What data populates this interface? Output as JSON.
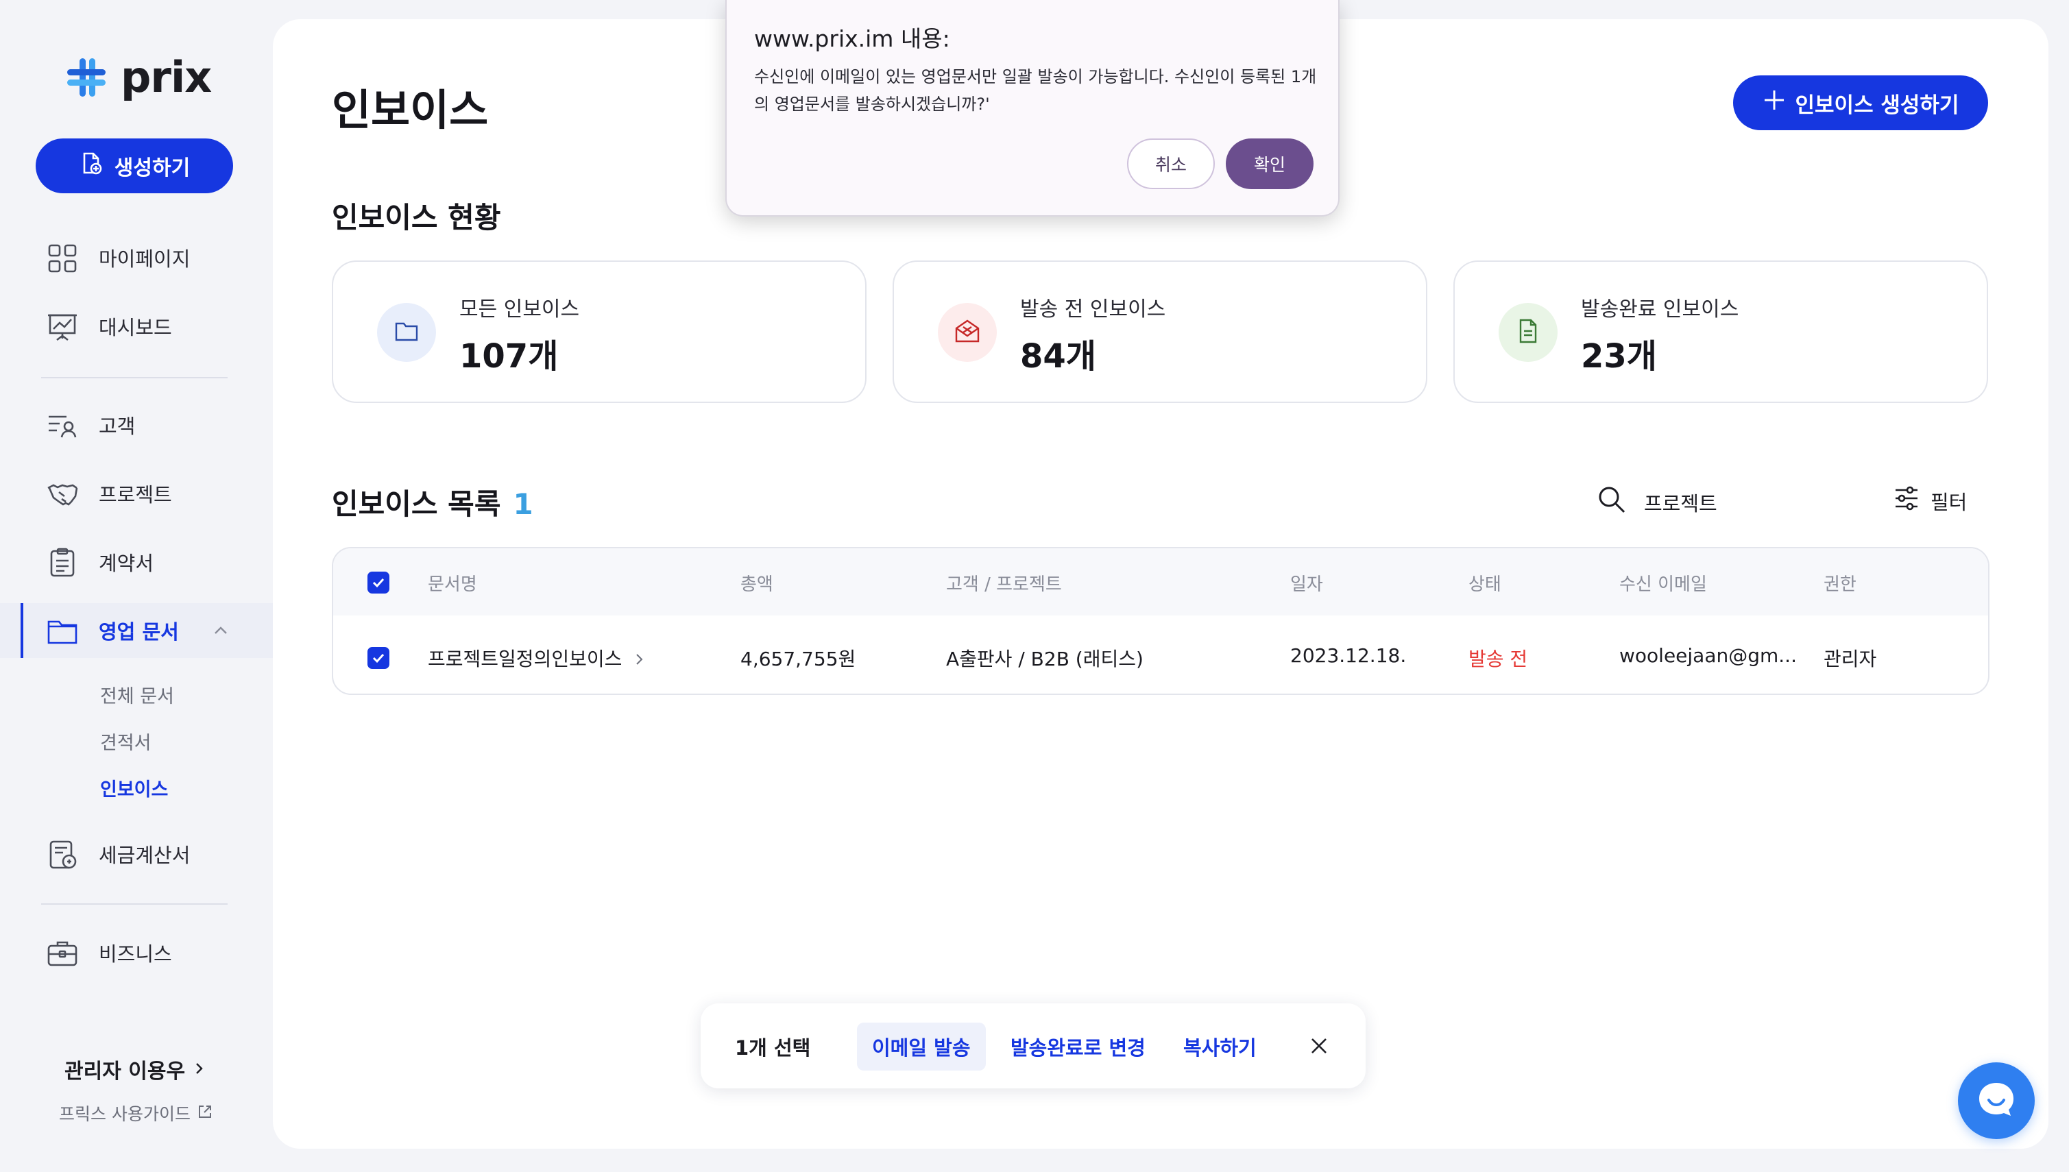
{
  "brand": {
    "name": "prix",
    "accent": "#1637e0"
  },
  "sidebar": {
    "create_label": "생성하기",
    "items": [
      {
        "label": "마이페이지",
        "icon": "grid-icon"
      },
      {
        "label": "대시보드",
        "icon": "chart-board-icon"
      },
      {
        "label": "고객",
        "icon": "customer-list-icon"
      },
      {
        "label": "프로젝트",
        "icon": "handshake-icon"
      },
      {
        "label": "계약서",
        "icon": "clipboard-icon"
      },
      {
        "label": "영업 문서",
        "icon": "folder-icon"
      },
      {
        "label": "세금계산서",
        "icon": "receipt-icon"
      },
      {
        "label": "비즈니스",
        "icon": "briefcase-icon"
      }
    ],
    "sub_items": [
      "전체 문서",
      "견적서",
      "인보이스"
    ],
    "admin_name": "관리자 이용우",
    "guide_label": "프릭스 사용가이드"
  },
  "main": {
    "title": "인보이스",
    "create_invoice_label": "인보이스 생성하기",
    "status_title": "인보이스 현황",
    "stats": [
      {
        "label": "모든 인보이스",
        "value": "107개",
        "icon": "folder-icon",
        "color": "#e8eefb"
      },
      {
        "label": "발송 전 인보이스",
        "value": "84개",
        "icon": "mail-open-icon",
        "color": "#fdecec"
      },
      {
        "label": "발송완료 인보이스",
        "value": "23개",
        "icon": "document-icon",
        "color": "#e9f5e6"
      }
    ],
    "list_title": "인보이스 목록",
    "list_count": "1",
    "search_placeholder": "프로젝트",
    "filter_label": "필터",
    "table": {
      "columns": [
        "문서명",
        "총액",
        "고객 / 프로젝트",
        "일자",
        "상태",
        "수신 이메일",
        "권한"
      ],
      "rows": [
        {
          "name": "프로젝트일정의인보이스",
          "total": "4,657,755원",
          "client": "A출판사 / B2B (래티스)",
          "date": "2023.12.18.",
          "status": "발송 전",
          "email": "wooleejaan@gm...",
          "role": "관리자"
        }
      ]
    }
  },
  "action_bar": {
    "selected": "1개 선택",
    "email_send": "이메일 발송",
    "mark_sent": "발송완료로 변경",
    "copy": "복사하기"
  },
  "dialog": {
    "title": "www.prix.im 내용:",
    "message": "수신인에 이메일이 있는 영업문서만 일괄 발송이 가능합니다. 수신인이 등록된 1개의 영업문서를 발송하시겠습니까?'",
    "cancel": "취소",
    "ok": "확인"
  }
}
